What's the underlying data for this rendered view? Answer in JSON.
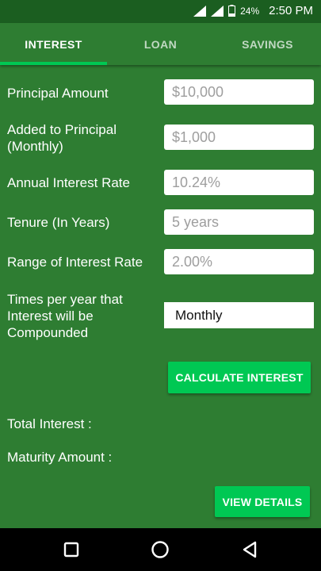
{
  "status_bar": {
    "battery": "24%",
    "time": "2:50 PM"
  },
  "tabs": [
    {
      "label": "INTEREST"
    },
    {
      "label": "LOAN"
    },
    {
      "label": "SAVINGS"
    }
  ],
  "form": {
    "principal": {
      "label": "Principal Amount",
      "placeholder": "$10,000"
    },
    "added": {
      "label": "Added to Principal (Monthly)",
      "placeholder": "$1,000"
    },
    "rate": {
      "label": "Annual Interest Rate",
      "placeholder": "10.24%"
    },
    "tenure": {
      "label": "Tenure (In Years)",
      "placeholder": "5 years"
    },
    "range": {
      "label": "Range of Interest Rate",
      "placeholder": "2.00%"
    },
    "compound": {
      "label": "Times per year that Interest will be Compounded",
      "value": "Monthly"
    }
  },
  "buttons": {
    "calculate": "CALCULATE INTEREST",
    "view_details": "VIEW DETAILS"
  },
  "results": {
    "total_interest": "Total Interest :",
    "maturity_amount": "Maturity Amount :"
  },
  "colors": {
    "background": "#2e7d32",
    "status_bar": "#1b5e20",
    "accent": "#00c853"
  }
}
